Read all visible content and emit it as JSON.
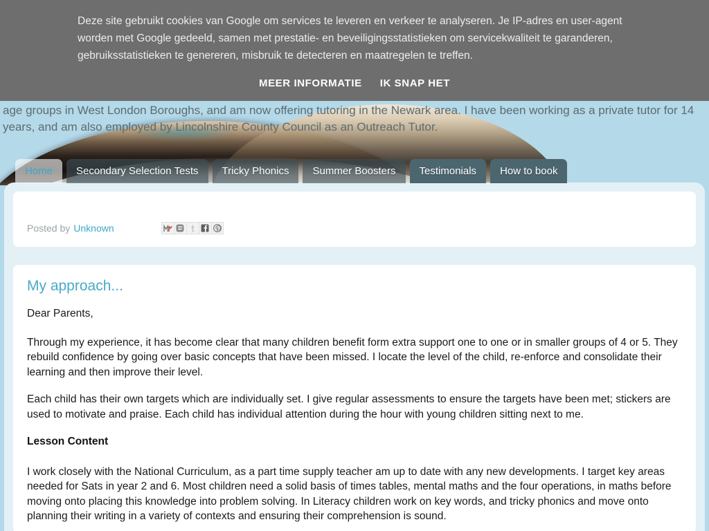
{
  "cookie_banner": {
    "message": "Deze site gebruikt cookies van Google om services te leveren en verkeer te analyseren. Je IP-adres en user-agent worden met Google gedeeld, samen met prestatie- en beveiligingsstatistieken om servicekwaliteit te garanderen, gebruiksstatistieken te genereren, misbruik te detecteren en maatregelen te treffen.",
    "more_info_label": "MEER INFORMATIE",
    "accept_label": "IK SNAP HET",
    "background_color": "#6e6e6e",
    "text_color": "#ededed"
  },
  "header": {
    "description": "age groups in West London Boroughs, and am now offering tutoring in the Newark area. I have been working as a private tutor for 14 years, and am also employed by Lincolnshire County Council as an Outreach Tutor.",
    "photo_alt": "stack-of-open-books-photo",
    "page_background_color": "#b4d9e9"
  },
  "nav": {
    "tabs": [
      {
        "label": "Home",
        "active": true,
        "style": "active"
      },
      {
        "label": "Secondary Selection Tests",
        "active": false,
        "style": "translucent"
      },
      {
        "label": "Tricky Phonics",
        "active": false,
        "style": "translucent"
      },
      {
        "label": "Summer Boosters",
        "active": false,
        "style": "translucent"
      },
      {
        "label": "Testimonials",
        "active": false,
        "style": "solid"
      },
      {
        "label": "How to book",
        "active": false,
        "style": "solid"
      }
    ],
    "active_tab_color": "#3aa8cc",
    "tab_color": "#4c666f"
  },
  "post_meta": {
    "posted_by_label": "Posted by",
    "author": "Unknown",
    "share_buttons": [
      {
        "name": "email-share-icon",
        "title": "Email This",
        "glyph": "M"
      },
      {
        "name": "blogger-share-icon",
        "title": "BlogThis!",
        "glyph": "B"
      },
      {
        "name": "twitter-share-icon",
        "title": "Share to Twitter",
        "glyph": "t"
      },
      {
        "name": "facebook-share-icon",
        "title": "Share to Facebook",
        "glyph": "f"
      },
      {
        "name": "pinterest-share-icon",
        "title": "Share to Pinterest",
        "glyph": "P"
      }
    ]
  },
  "post": {
    "title": "My approach...",
    "salutation": "Dear Parents,",
    "paragraph1": "Through my experience, it has become clear that many children benefit form extra support one to one or in smaller groups of 4 or 5.  They rebuild confidence by going over basic concepts that have been missed.  I locate the level of the child, re-enforce and consolidate their learning and then improve their level.",
    "paragraph2": "Each child has their own targets which are individually set.  I give regular assessments to ensure the targets have been met; stickers are used to motivate and praise.  Each child has individual attention during the hour with young children sitting next to me.",
    "subheading": "Lesson Content",
    "paragraph3": "I work closely with the National Curriculum, as a part time supply teacher am up to date with any new developments. I target key areas needed for Sats in year 2 and 6.  Most children need a solid basis of times tables, mental maths and the four operations, in maths before moving onto placing this knowledge into problem solving.  In Literacy children work on key words, and tricky phonics and move onto planning their writing in a variety of contexts and ensuring their comprehension is sound.",
    "title_color": "#4aa8c9"
  }
}
